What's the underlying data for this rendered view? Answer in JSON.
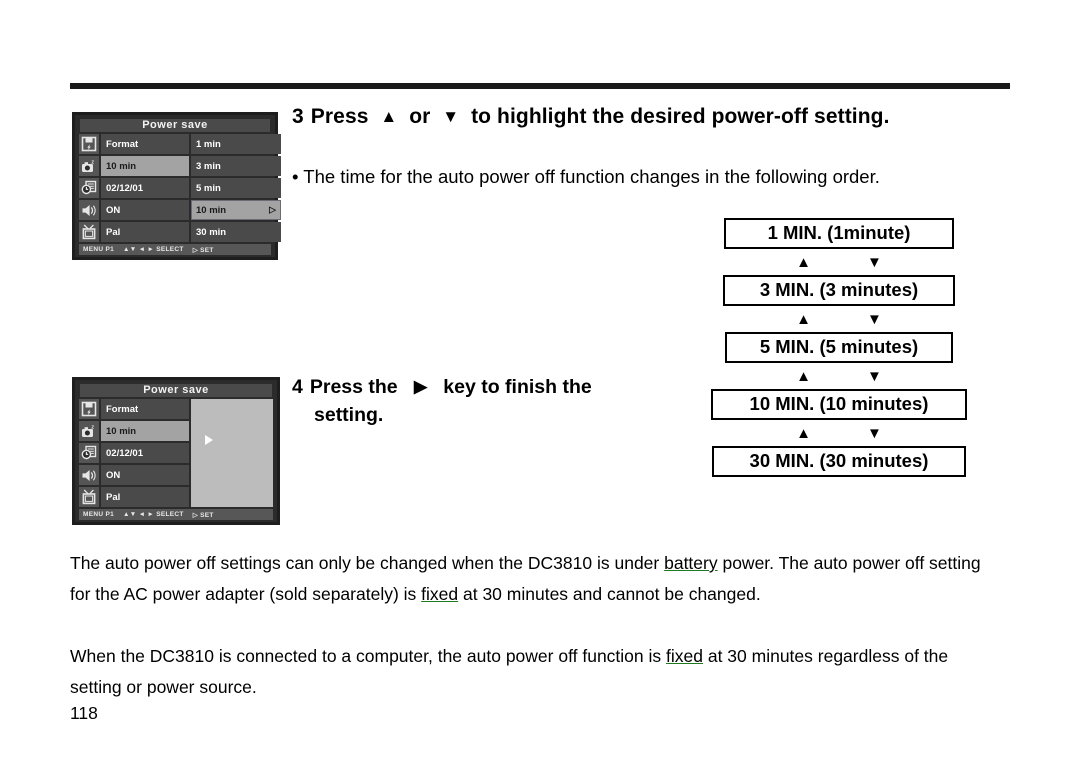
{
  "page": {
    "number": "118"
  },
  "screens": [
    {
      "id": "screen-step3",
      "title": "Power save",
      "icons": [
        "floppy-disk-icon",
        "camera-sleep-icon",
        "clock-date-icon",
        "speaker-icon",
        "tv-icon"
      ],
      "left_column": [
        "Format",
        "10 min",
        "02/12/01",
        "ON",
        "Pal"
      ],
      "left_selected_index": 1,
      "right_column": [
        "1 min",
        "3 min",
        "5 min",
        "10 min",
        "30 min"
      ],
      "right_selected_index": 3,
      "right_selected_caret": "▷",
      "status": [
        "MENU P1",
        "▲▼ ◄ ► SELECT",
        "▷ SET"
      ]
    },
    {
      "id": "screen-step4",
      "title": "Power save",
      "icons": [
        "floppy-disk-icon",
        "camera-sleep-icon",
        "clock-date-icon",
        "speaker-icon",
        "tv-icon"
      ],
      "left_column": [
        "Format",
        "10 min",
        "02/12/01",
        "ON",
        "Pal"
      ],
      "left_selected_index": 1,
      "right_panel": "blank-gray-panel",
      "right_panel_glyph": "play-triangle-icon",
      "status": [
        "MENU P1",
        "▲▼ ◄ ► SELECT",
        "▷ SET"
      ]
    }
  ],
  "step3": {
    "number": "3",
    "text_a": "Press",
    "up_glyph": "▲",
    "text_b": "or",
    "down_glyph": "▼",
    "text_c": "to highlight the desired power-off setting.",
    "bullet": "• The time for the auto power off function changes in the following order."
  },
  "step4": {
    "number": "4",
    "text_a": "Press the",
    "right_glyph": "▶",
    "text_b": "key to finish the",
    "text_c": "setting."
  },
  "chart_data": {
    "type": "diagram-flow",
    "title": "Auto power off time order",
    "boxes": [
      "1 MIN. (1minute)",
      "3 MIN. (3 minutes)",
      "5 MIN. (5 minutes)",
      "10 MIN. (10 minutes)",
      "30 MIN. (30 minutes)"
    ],
    "connector_up": "▲",
    "connector_down": "▼"
  },
  "footer": {
    "p1_a": "The auto power off settings can only be changed when the DC3810 is under ",
    "p1_u": "battery",
    "p1_b": " power. The auto power off setting for the AC power adapter (sold separately) is ",
    "p1_u2": "fixed",
    "p1_c": " at 30 minutes and cannot be changed.",
    "p2_a": "When the DC3810 is connected to a computer, the auto power off function is ",
    "p2_u": "fixed",
    "p2_b": " at 30 minutes regardless of the setting or power source."
  },
  "colors": {
    "rule": "#1a1a1a",
    "lcd_bg": "#2b2b2b",
    "lcd_cell": "#4a4a4a",
    "lcd_selected": "#a3a3a3",
    "lcd_panel": "#bcbcbc",
    "underline_green": "#1e7a1e"
  }
}
